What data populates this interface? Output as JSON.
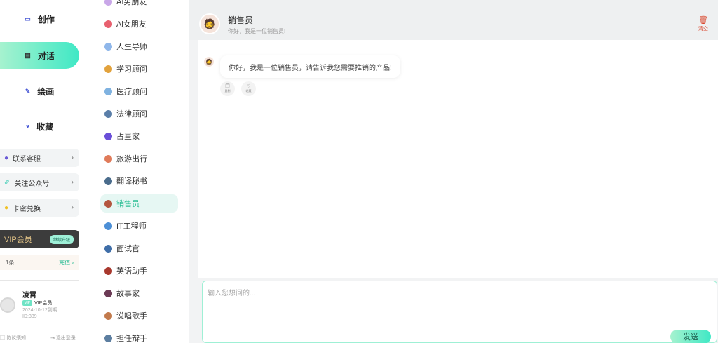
{
  "nav": {
    "items": [
      {
        "label": "创作",
        "icon": "card-icon"
      },
      {
        "label": "对话",
        "icon": "chat-icon"
      },
      {
        "label": "绘画",
        "icon": "brush-icon"
      },
      {
        "label": "收藏",
        "icon": "heart-icon"
      }
    ],
    "side_buttons": [
      {
        "label": "联系客服",
        "icon": "people-icon"
      },
      {
        "label": "关注公众号",
        "icon": "pen-icon"
      },
      {
        "label": "卡密兑换",
        "icon": "coin-icon"
      }
    ],
    "vip": {
      "title": "VIP会员",
      "upgrade": "继续升级",
      "count": "1条",
      "recharge": "充值"
    },
    "user": {
      "name": "凌霄",
      "badge": "VIP",
      "level": "VIP会员",
      "expiry": "2024-10-12到期",
      "id": "ID:339"
    },
    "footer": {
      "agreement": "协议须知",
      "logout": "退出登录"
    }
  },
  "roles": [
    {
      "label": "AI男朋友",
      "color": "#c9a7e8"
    },
    {
      "label": "Ai女朋友",
      "color": "#e8606f"
    },
    {
      "label": "人生导师",
      "color": "#8fb7ea"
    },
    {
      "label": "学习顾问",
      "color": "#e2a23c"
    },
    {
      "label": "医疗顾问",
      "color": "#7fb2e0"
    },
    {
      "label": "法律顾问",
      "color": "#5a7ea8"
    },
    {
      "label": "占星家",
      "color": "#6a4fd8"
    },
    {
      "label": "旅游出行",
      "color": "#e07b5a"
    },
    {
      "label": "翻译秘书",
      "color": "#4a6c8c"
    },
    {
      "label": "销售员",
      "color": "#b3573f"
    },
    {
      "label": "IT工程师",
      "color": "#4c8fd6"
    },
    {
      "label": "面试官",
      "color": "#3f6ea8"
    },
    {
      "label": "英语助手",
      "color": "#a8382d"
    },
    {
      "label": "故事家",
      "color": "#6b3a55"
    },
    {
      "label": "说唱歌手",
      "color": "#c27a4c"
    },
    {
      "label": "担任辩手",
      "color": "#5c7ea0"
    }
  ],
  "active_role_index": 9,
  "chat": {
    "title": "销售员",
    "subtitle": "你好，我是一位销售员!",
    "clear_label": "清空",
    "message": "你好，我是一位销售员，请告诉我您需要推销的产品!",
    "copy_label": "复制",
    "fav_label": "收藏",
    "input_placeholder": "输入您想问的...",
    "send_label": "发送"
  },
  "colors": {
    "accent": "#3fe8c5",
    "accent_light": "#a6f2cf",
    "danger": "#d9442a",
    "vip_gold": "#e8c88a"
  }
}
